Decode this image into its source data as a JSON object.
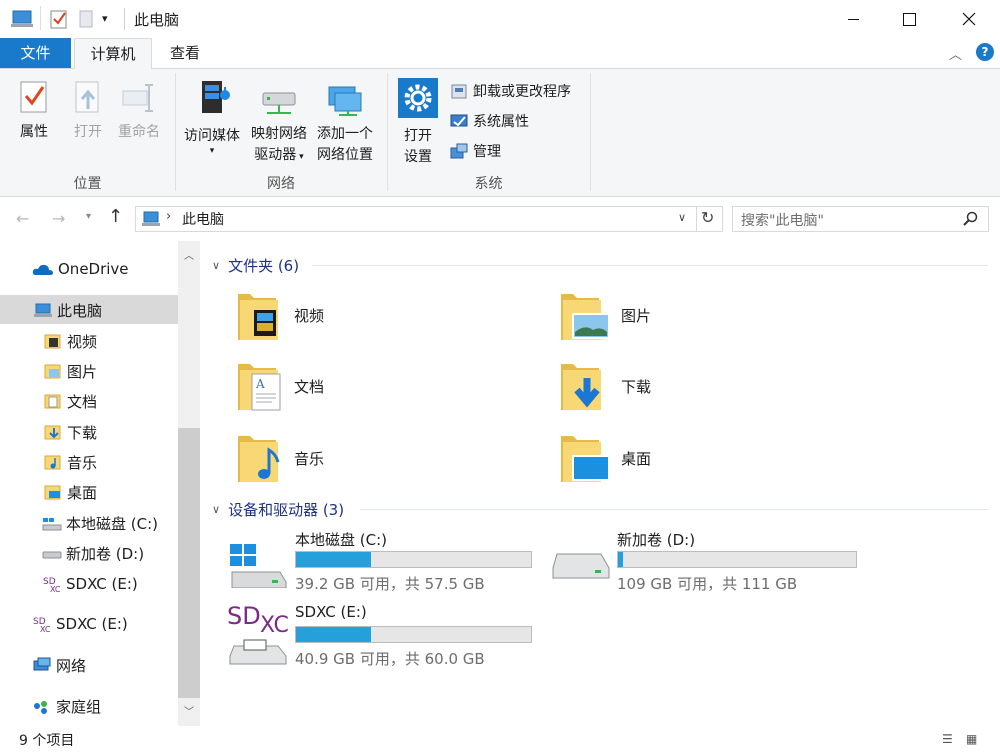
{
  "window": {
    "title": "此电脑",
    "minimize_icon": "minimize-icon",
    "maximize_icon": "maximize-icon",
    "close_icon": "close-icon"
  },
  "ribbon_tabs": {
    "file": "文件",
    "computer": "计算机",
    "view": "查看"
  },
  "ribbon": {
    "groups": {
      "location": "位置",
      "network": "网络",
      "system": "系统"
    },
    "buttons": {
      "properties": "属性",
      "open": "打开",
      "rename": "重命名",
      "access_media": "访问媒体",
      "map_drive_line1": "映射网络",
      "map_drive_line2": "驱动器",
      "add_location_line1": "添加一个",
      "add_location_line2": "网络位置",
      "open_settings_line1": "打开",
      "open_settings_line2": "设置",
      "uninstall": "卸载或更改程序",
      "system_properties": "系统属性",
      "manage": "管理"
    }
  },
  "address": {
    "path": "此电脑",
    "search_placeholder": "搜索\"此电脑\""
  },
  "nav": {
    "onedrive": "OneDrive",
    "this_pc": "此电脑",
    "videos": "视频",
    "pictures": "图片",
    "documents": "文档",
    "downloads": "下载",
    "music": "音乐",
    "desktop": "桌面",
    "local_disk": "本地磁盘 (C:)",
    "new_volume": "新加卷 (D:)",
    "sdxc_sub": "SDXC (E:)",
    "sdxc": "SDXC (E:)",
    "network": "网络",
    "homegroup": "家庭组"
  },
  "content": {
    "folders_header": "文件夹 (6)",
    "folders": [
      "视频",
      "图片",
      "文档",
      "下载",
      "音乐",
      "桌面"
    ],
    "devices_header": "设备和驱动器 (3)",
    "drives": [
      {
        "name": "本地磁盘 (C:)",
        "info": "39.2 GB 可用，共 57.5 GB",
        "used_fraction": 0.32
      },
      {
        "name": "新加卷 (D:)",
        "info": "109 GB 可用，共 111 GB",
        "used_fraction": 0.02
      },
      {
        "name": "SDXC (E:)",
        "info": "40.9 GB 可用，共 60.0 GB",
        "used_fraction": 0.32
      }
    ]
  },
  "status": {
    "item_count": "9 个项目"
  },
  "colors": {
    "accent": "#1979ca",
    "drive_bar": "#26a0da",
    "folder": "#f8d775"
  }
}
